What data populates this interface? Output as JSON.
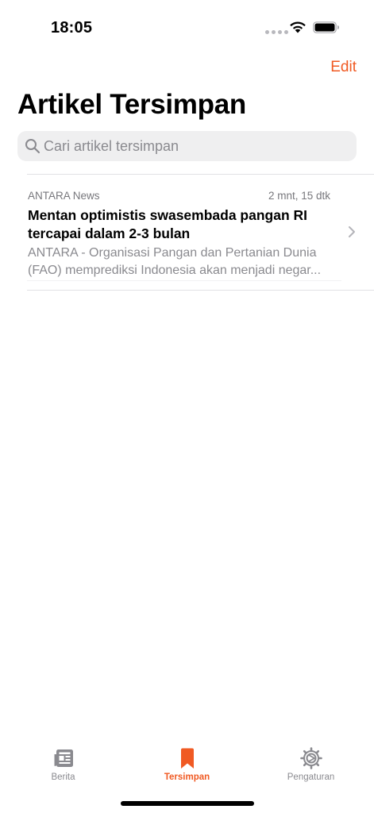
{
  "status_bar": {
    "time": "18:05"
  },
  "nav": {
    "edit_label": "Edit",
    "title": "Artikel Tersimpan"
  },
  "search": {
    "placeholder": "Cari artikel tersimpan",
    "value": ""
  },
  "articles": [
    {
      "source": "ANTARA News",
      "time": "2 mnt, 15 dtk",
      "title": "Mentan optimistis swasembada pangan RI tercapai dalam 2-3 bulan",
      "snippet": "ANTARA - Organisasi Pangan dan Pertanian Dunia (FAO) memprediksi Indonesia akan menjadi negar..."
    }
  ],
  "tab_bar": {
    "items": [
      {
        "label": "Berita",
        "icon": "newspaper-icon"
      },
      {
        "label": "Tersimpan",
        "icon": "bookmark-icon",
        "active": true
      },
      {
        "label": "Pengaturan",
        "icon": "gear-icon"
      }
    ]
  },
  "colors": {
    "accent": "#f05a23",
    "secondary_text": "#8a8a8f",
    "search_bg": "#efeff0"
  }
}
